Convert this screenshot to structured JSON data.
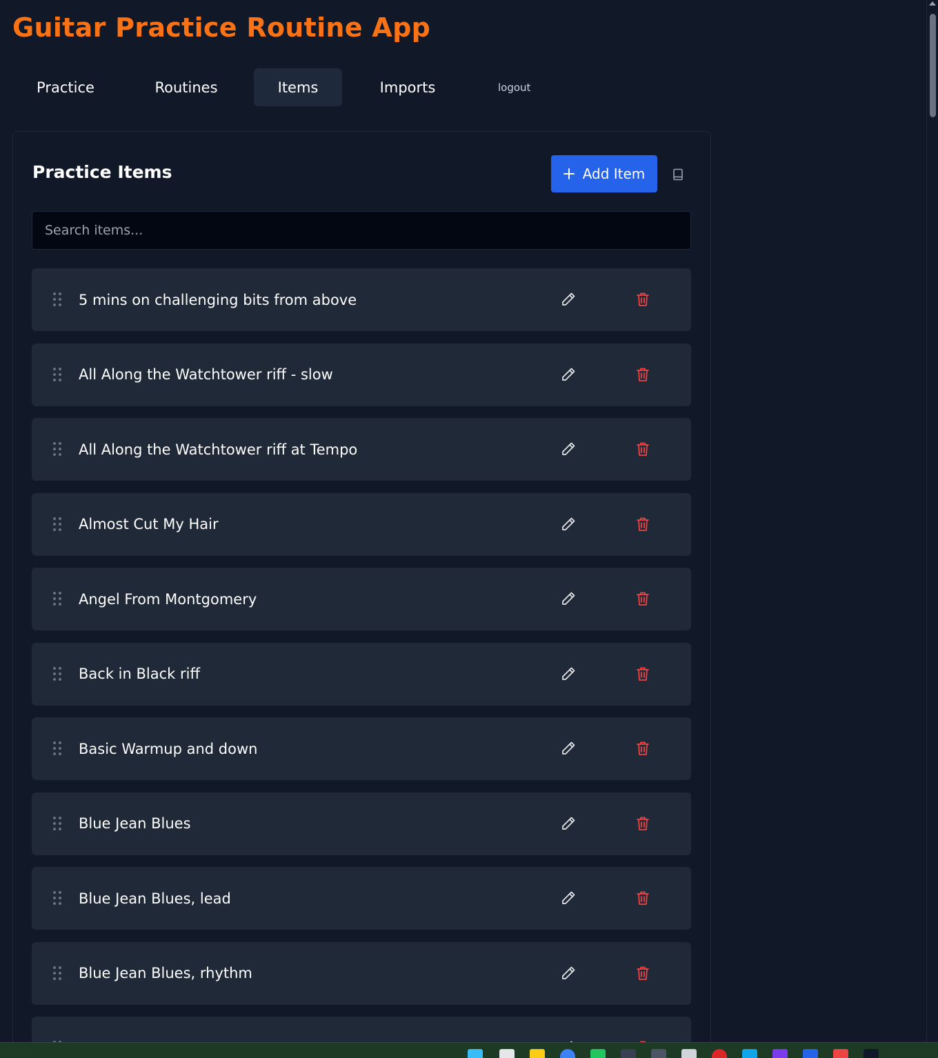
{
  "app": {
    "title": "Guitar Practice Routine App"
  },
  "nav": {
    "tabs": [
      {
        "label": "Practice",
        "active": false
      },
      {
        "label": "Routines",
        "active": false
      },
      {
        "label": "Items",
        "active": true
      },
      {
        "label": "Imports",
        "active": false
      }
    ],
    "logout_label": "logout"
  },
  "panel": {
    "title": "Practice Items",
    "add_button_label": "Add Item",
    "add_button_icon": "plus-icon",
    "extra_button_icon": "book-icon"
  },
  "search": {
    "placeholder": "Search items...",
    "value": ""
  },
  "items": [
    {
      "label": "5 mins on challenging bits from above"
    },
    {
      "label": "All Along the Watchtower riff - slow"
    },
    {
      "label": "All Along the Watchtower riff at Tempo"
    },
    {
      "label": "Almost Cut My Hair"
    },
    {
      "label": "Angel From Montgomery"
    },
    {
      "label": "Back in Black riff"
    },
    {
      "label": "Basic Warmup and down"
    },
    {
      "label": "Blue Jean Blues"
    },
    {
      "label": "Blue Jean Blues, lead"
    },
    {
      "label": "Blue Jean Blues, rhythm"
    },
    {
      "label": ""
    }
  ],
  "item_icons": {
    "drag": "drag-handle-icon",
    "edit": "pencil-icon",
    "delete": "trash-icon"
  },
  "colors": {
    "background": "#111827",
    "title": "#f97316",
    "accent": "#2563eb",
    "item_bg": "#1f2937",
    "delete": "#ef4444"
  }
}
